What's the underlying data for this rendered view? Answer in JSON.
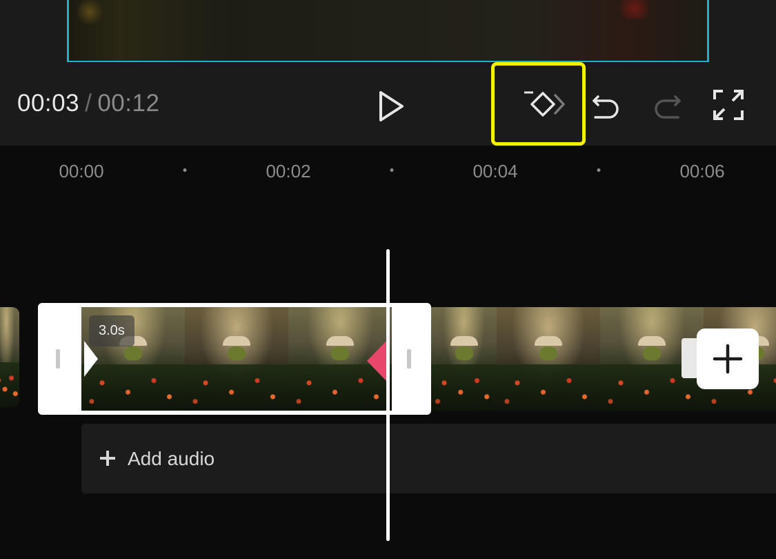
{
  "timecode": {
    "current": "00:03",
    "separator": "/",
    "total": "00:12"
  },
  "toolbar": {
    "play_icon": "play-icon",
    "keyframe_icon": "add-keyframe-icon",
    "undo_icon": "undo-icon",
    "redo_icon": "redo-icon",
    "fullscreen_icon": "fullscreen-icon",
    "highlight_color": "#f5f000"
  },
  "ruler": {
    "labels": [
      "00:00",
      "00:02",
      "00:04",
      "00:06"
    ]
  },
  "timeline": {
    "selected_clip_duration": "3.0s",
    "add_clip_icon": "plus-icon",
    "keyframe_color": "#e8466b",
    "preview_border_color": "#18b4cf"
  },
  "audio": {
    "label": "Add audio",
    "icon": "plus-icon"
  }
}
